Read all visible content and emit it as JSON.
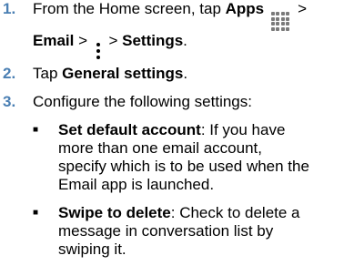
{
  "steps": [
    {
      "number": "1.",
      "line1": {
        "t1": "From the Home screen, tap ",
        "b1": "Apps",
        "icon": "apps-grid-icon",
        "t2": " >"
      },
      "line2": {
        "b1": "Email",
        "t1": " > ",
        "icon": "menu-icon",
        "t2": " > ",
        "b2": "Settings",
        "t3": "."
      }
    },
    {
      "number": "2.",
      "t1": "Tap ",
      "b1": "General settings",
      "t2": "."
    },
    {
      "number": "3.",
      "text": "Configure the following settings:"
    }
  ],
  "bullets": [
    {
      "bullet": "■",
      "label": "Set default account",
      "lines": [
        ": If you have",
        "more than one email account,",
        "specify which is to be used when the",
        "Email app is launched."
      ]
    },
    {
      "bullet": "■",
      "label": "Swipe to delete",
      "lines": [
        ": Check to delete a",
        "message in conversation list by",
        "swiping it."
      ]
    }
  ]
}
